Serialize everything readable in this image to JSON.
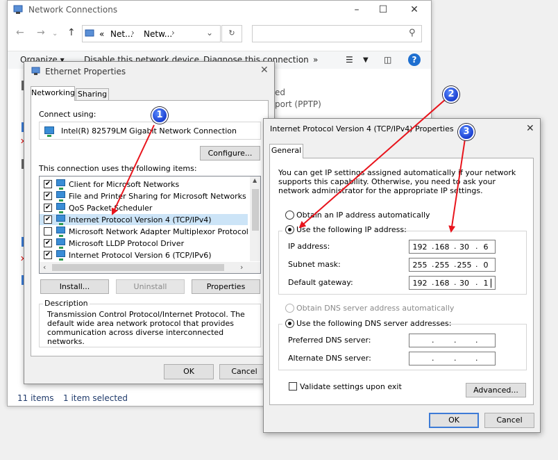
{
  "net_window": {
    "title": "Network Connections",
    "breadcrumb": [
      "«",
      "Net...",
      "Netw..."
    ],
    "commands": [
      "Organize",
      "Disable this network device",
      "Diagnose this connection",
      "»"
    ],
    "background_text": [
      "ed",
      "port (PPTP)"
    ],
    "status_items": "11 items",
    "status_selected": "1 item selected"
  },
  "eth_dialog": {
    "title": "Ethernet Properties",
    "tabs": [
      "Networking",
      "Sharing"
    ],
    "connect_using_label": "Connect using:",
    "adapter": "Intel(R) 82579LM Gigabit Network Connection",
    "configure_button": "Configure...",
    "items_label": "This connection uses the following items:",
    "items": [
      {
        "label": "Client for Microsoft Networks",
        "checked": true
      },
      {
        "label": "File and Printer Sharing for Microsoft Networks",
        "checked": true
      },
      {
        "label": "QoS Packet Scheduler",
        "checked": true
      },
      {
        "label": "Internet Protocol Version 4 (TCP/IPv4)",
        "checked": true
      },
      {
        "label": "Microsoft Network Adapter Multiplexor Protocol",
        "checked": false
      },
      {
        "label": "Microsoft LLDP Protocol Driver",
        "checked": true
      },
      {
        "label": "Internet Protocol Version 6 (TCP/IPv6)",
        "checked": true
      }
    ],
    "install_button": "Install...",
    "uninstall_button": "Uninstall",
    "properties_button": "Properties",
    "description_heading": "Description",
    "description_text": "Transmission Control Protocol/Internet Protocol. The default wide area network protocol that provides communication across diverse interconnected networks.",
    "ok_button": "OK",
    "cancel_button": "Cancel"
  },
  "ipv4_dialog": {
    "title": "Internet Protocol Version 4 (TCP/IPv4) Properties",
    "tab": "General",
    "intro": "You can get IP settings assigned automatically if your network supports this capability. Otherwise, you need to ask your network administrator for the appropriate IP settings.",
    "obtain_ip_auto": "Obtain an IP address automatically",
    "use_following_ip": "Use the following IP address:",
    "ip_label": "IP address:",
    "ip_value": [
      "192",
      "168",
      "30",
      "6"
    ],
    "subnet_label": "Subnet mask:",
    "subnet_value": [
      "255",
      "255",
      "255",
      "0"
    ],
    "gateway_label": "Default gateway:",
    "gateway_value": [
      "192",
      "168",
      "30",
      "1"
    ],
    "obtain_dns_auto": "Obtain DNS server address automatically",
    "use_following_dns": "Use the following DNS server addresses:",
    "preferred_dns_label": "Preferred DNS server:",
    "alternate_dns_label": "Alternate DNS server:",
    "validate_label": "Validate settings upon exit",
    "advanced_button": "Advanced...",
    "ok_button": "OK",
    "cancel_button": "Cancel"
  },
  "markers": [
    "1",
    "2",
    "3"
  ],
  "colors": {
    "arrow": "#e8141c",
    "marker": "#1b3fd0",
    "focus": "#3d7bd6"
  }
}
